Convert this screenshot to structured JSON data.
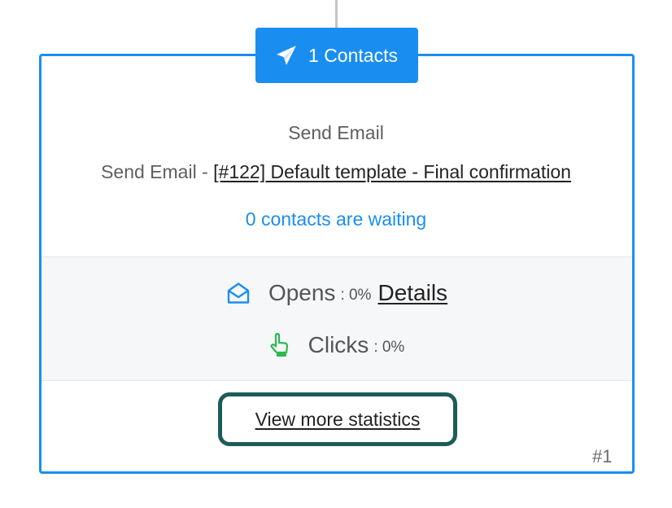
{
  "node": {
    "contacts_label": "1 Contacts",
    "icon": "paper-plane-icon",
    "action_title": "Send Email",
    "action_prefix": "Send Email - ",
    "template_link": "[#122] Default template - Final confirmation",
    "waiting_text": "0 contacts are waiting",
    "step_number": "#1"
  },
  "stats": {
    "opens": {
      "label": "Opens",
      "value": ": 0%",
      "details_label": "Details",
      "icon": "envelope-open-icon"
    },
    "clicks": {
      "label": "Clicks",
      "value": ": 0%",
      "icon": "pointing-hand-icon"
    }
  },
  "view_more_label": "View more statistics",
  "colors": {
    "accent": "#1a8ef0",
    "highlight_outline": "#1b5c58",
    "clicks_icon": "#2db84d",
    "stats_background": "#f6f7f9"
  }
}
